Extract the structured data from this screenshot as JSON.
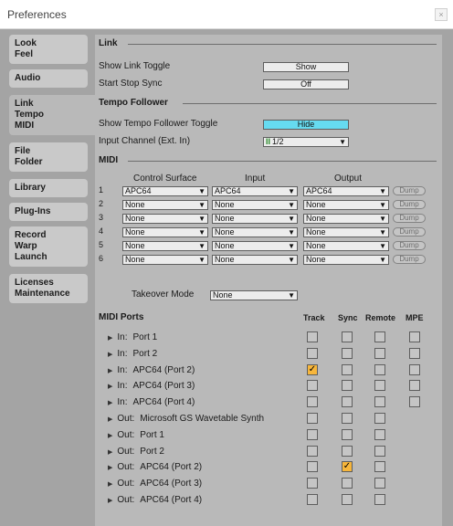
{
  "window": {
    "title": "Preferences",
    "close_glyph": "×"
  },
  "sidebar": {
    "tabs": [
      {
        "lines": [
          "Look",
          "Feel"
        ]
      },
      {
        "lines": [
          "Audio"
        ]
      },
      {
        "lines": [
          "Link",
          "Tempo",
          "MIDI"
        ],
        "active": true
      },
      {
        "lines": [
          "File",
          "Folder"
        ]
      },
      {
        "lines": [
          "Library"
        ]
      },
      {
        "lines": [
          "Plug-Ins"
        ]
      },
      {
        "lines": [
          "Record",
          "Warp",
          "Launch"
        ]
      },
      {
        "lines": [
          "Licenses",
          "Maintenance"
        ]
      }
    ]
  },
  "link": {
    "section": "Link",
    "show_toggle_label": "Show Link Toggle",
    "show_toggle_value": "Show",
    "start_stop_label": "Start Stop Sync",
    "start_stop_value": "Off"
  },
  "tempo": {
    "section": "Tempo Follower",
    "show_toggle_label": "Show Tempo Follower Toggle",
    "show_toggle_value": "Hide",
    "input_label": "Input Channel (Ext. In)",
    "input_value": "1/2",
    "input_icon": "II"
  },
  "midi": {
    "section": "MIDI",
    "headers": {
      "surface": "Control Surface",
      "input": "Input",
      "output": "Output"
    },
    "rows": [
      {
        "num": "1",
        "surface": "APC64",
        "input": "APC64",
        "output": "APC64",
        "dump": "Dump"
      },
      {
        "num": "2",
        "surface": "None",
        "input": "None",
        "output": "None",
        "dump": "Dump"
      },
      {
        "num": "3",
        "surface": "None",
        "input": "None",
        "output": "None",
        "dump": "Dump"
      },
      {
        "num": "4",
        "surface": "None",
        "input": "None",
        "output": "None",
        "dump": "Dump"
      },
      {
        "num": "5",
        "surface": "None",
        "input": "None",
        "output": "None",
        "dump": "Dump"
      },
      {
        "num": "6",
        "surface": "None",
        "input": "None",
        "output": "None",
        "dump": "Dump"
      }
    ],
    "takeover_label": "Takeover Mode",
    "takeover_value": "None",
    "dropdown_arrow": "▼"
  },
  "ports": {
    "title": "MIDI Ports",
    "columns": [
      "Track",
      "Sync",
      "Remote",
      "MPE"
    ],
    "expand_glyph": "▶",
    "check_glyph": "✓",
    "items": [
      {
        "dir": "In:",
        "name": "Port 1",
        "boxes": [
          false,
          false,
          false,
          false
        ]
      },
      {
        "dir": "In:",
        "name": "Port 2",
        "boxes": [
          false,
          false,
          false,
          false
        ]
      },
      {
        "dir": "In:",
        "name": "APC64 (Port 2)",
        "boxes": [
          true,
          false,
          false,
          false
        ]
      },
      {
        "dir": "In:",
        "name": "APC64 (Port 3)",
        "boxes": [
          false,
          false,
          false,
          false
        ]
      },
      {
        "dir": "In:",
        "name": "APC64 (Port 4)",
        "boxes": [
          false,
          false,
          false,
          false
        ]
      },
      {
        "dir": "Out:",
        "name": "Microsoft GS Wavetable Synth",
        "boxes": [
          false,
          false,
          false
        ]
      },
      {
        "dir": "Out:",
        "name": "Port 1",
        "boxes": [
          false,
          false,
          false
        ]
      },
      {
        "dir": "Out:",
        "name": "Port 2",
        "boxes": [
          false,
          false,
          false
        ]
      },
      {
        "dir": "Out:",
        "name": "APC64 (Port 2)",
        "boxes": [
          false,
          true,
          false
        ]
      },
      {
        "dir": "Out:",
        "name": "APC64 (Port 3)",
        "boxes": [
          false,
          false,
          false
        ]
      },
      {
        "dir": "Out:",
        "name": "APC64 (Port 4)",
        "boxes": [
          false,
          false,
          false
        ]
      }
    ]
  },
  "colors": {
    "accent_cyan": "#66dbf0",
    "checked_orange": "#f7b63b",
    "background": "#a4a4a4",
    "panel": "#b9b9b9"
  }
}
